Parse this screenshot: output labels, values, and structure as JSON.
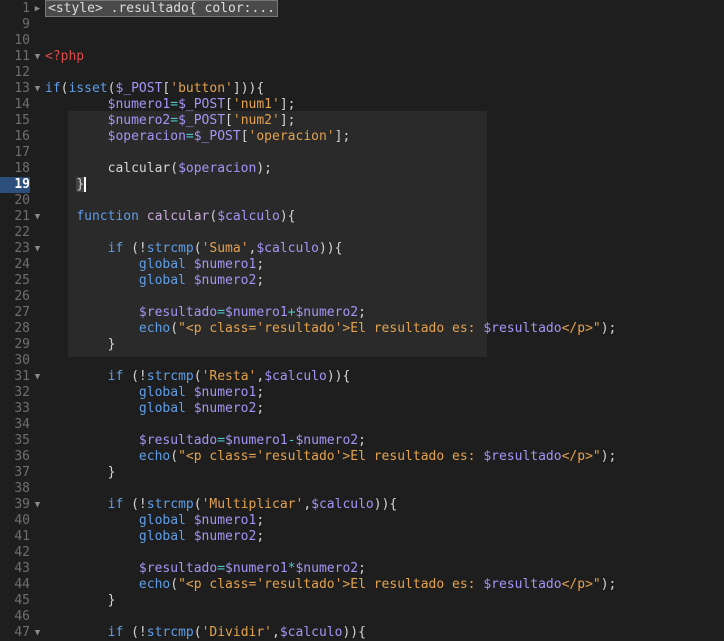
{
  "colors": {
    "background": "#1e1e1e",
    "keyword": "#5f9de8",
    "variable": "#a594f4",
    "string": "#e3a24e",
    "php_tag": "#e04848",
    "active_line": "#2c4f7c"
  },
  "active_line": 19,
  "lines": [
    {
      "n": 1,
      "fold": "collapsed",
      "t": [
        [
          "folded",
          "<style> .resultado{ color:..."
        ]
      ]
    },
    {
      "n": 9,
      "t": []
    },
    {
      "n": 10,
      "t": []
    },
    {
      "n": 11,
      "fold": "open",
      "t": [
        [
          "tag",
          "<?php"
        ]
      ]
    },
    {
      "n": 12,
      "t": []
    },
    {
      "n": 13,
      "fold": "open",
      "t": [
        [
          "kw",
          "if"
        ],
        [
          "p",
          "("
        ],
        [
          "kw",
          "isset"
        ],
        [
          "p",
          "("
        ],
        [
          "var",
          "$_POST"
        ],
        [
          "p",
          "["
        ],
        [
          "str",
          "'button'"
        ],
        [
          "p",
          "])){"
        ]
      ]
    },
    {
      "n": 14,
      "t": [
        [
          "p",
          "        "
        ],
        [
          "var",
          "$numero1"
        ],
        [
          "op",
          "="
        ],
        [
          "var",
          "$_POST"
        ],
        [
          "p",
          "["
        ],
        [
          "str",
          "'num1'"
        ],
        [
          "p",
          "];"
        ]
      ]
    },
    {
      "n": 15,
      "t": [
        [
          "p",
          "        "
        ],
        [
          "var",
          "$numero2"
        ],
        [
          "op",
          "="
        ],
        [
          "var",
          "$_POST"
        ],
        [
          "p",
          "["
        ],
        [
          "str",
          "'num2'"
        ],
        [
          "p",
          "];"
        ]
      ]
    },
    {
      "n": 16,
      "t": [
        [
          "p",
          "        "
        ],
        [
          "var",
          "$operacion"
        ],
        [
          "op",
          "="
        ],
        [
          "var",
          "$_POST"
        ],
        [
          "p",
          "["
        ],
        [
          "str",
          "'operacion'"
        ],
        [
          "p",
          "];"
        ]
      ]
    },
    {
      "n": 17,
      "t": []
    },
    {
      "n": 18,
      "t": [
        [
          "p",
          "        calcular("
        ],
        [
          "var",
          "$operacion"
        ],
        [
          "p",
          ");"
        ]
      ]
    },
    {
      "n": 19,
      "t": [
        [
          "p",
          "    "
        ],
        [
          "cursor",
          "}"
        ]
      ]
    },
    {
      "n": 20,
      "t": []
    },
    {
      "n": 21,
      "fold": "open",
      "t": [
        [
          "p",
          "    "
        ],
        [
          "kw",
          "function"
        ],
        [
          "p",
          " "
        ],
        [
          "fn",
          "calcular"
        ],
        [
          "p",
          "("
        ],
        [
          "var",
          "$calculo"
        ],
        [
          "p",
          "){"
        ]
      ]
    },
    {
      "n": 22,
      "t": []
    },
    {
      "n": 23,
      "fold": "open",
      "t": [
        [
          "p",
          "        "
        ],
        [
          "kw",
          "if"
        ],
        [
          "p",
          " (!"
        ],
        [
          "kw",
          "strcmp"
        ],
        [
          "p",
          "("
        ],
        [
          "str",
          "'Suma'"
        ],
        [
          "p",
          ","
        ],
        [
          "var",
          "$calculo"
        ],
        [
          "p",
          ")){"
        ]
      ]
    },
    {
      "n": 24,
      "t": [
        [
          "p",
          "            "
        ],
        [
          "kw",
          "global"
        ],
        [
          "p",
          " "
        ],
        [
          "var",
          "$numero1"
        ],
        [
          "p",
          ";"
        ]
      ]
    },
    {
      "n": 25,
      "t": [
        [
          "p",
          "            "
        ],
        [
          "kw",
          "global"
        ],
        [
          "p",
          " "
        ],
        [
          "var",
          "$numero2"
        ],
        [
          "p",
          ";"
        ]
      ]
    },
    {
      "n": 26,
      "t": []
    },
    {
      "n": 27,
      "t": [
        [
          "p",
          "            "
        ],
        [
          "var",
          "$resultado"
        ],
        [
          "op",
          "="
        ],
        [
          "var",
          "$numero1"
        ],
        [
          "op",
          "+"
        ],
        [
          "var",
          "$numero2"
        ],
        [
          "p",
          ";"
        ]
      ]
    },
    {
      "n": 28,
      "t": [
        [
          "p",
          "            "
        ],
        [
          "kw",
          "echo"
        ],
        [
          "p",
          "("
        ],
        [
          "str",
          "\"<p class='resultado'>El resultado es: "
        ],
        [
          "var",
          "$resultado"
        ],
        [
          "str",
          "</p>\""
        ],
        [
          "p",
          ");"
        ]
      ]
    },
    {
      "n": 29,
      "t": [
        [
          "p",
          "        }"
        ]
      ]
    },
    {
      "n": 30,
      "t": []
    },
    {
      "n": 31,
      "fold": "open",
      "t": [
        [
          "p",
          "        "
        ],
        [
          "kw",
          "if"
        ],
        [
          "p",
          " (!"
        ],
        [
          "kw",
          "strcmp"
        ],
        [
          "p",
          "("
        ],
        [
          "str",
          "'Resta'"
        ],
        [
          "p",
          ","
        ],
        [
          "var",
          "$calculo"
        ],
        [
          "p",
          ")){"
        ]
      ]
    },
    {
      "n": 32,
      "t": [
        [
          "p",
          "            "
        ],
        [
          "kw",
          "global"
        ],
        [
          "p",
          " "
        ],
        [
          "var",
          "$numero1"
        ],
        [
          "p",
          ";"
        ]
      ]
    },
    {
      "n": 33,
      "t": [
        [
          "p",
          "            "
        ],
        [
          "kw",
          "global"
        ],
        [
          "p",
          " "
        ],
        [
          "var",
          "$numero2"
        ],
        [
          "p",
          ";"
        ]
      ]
    },
    {
      "n": 34,
      "t": []
    },
    {
      "n": 35,
      "t": [
        [
          "p",
          "            "
        ],
        [
          "var",
          "$resultado"
        ],
        [
          "op",
          "="
        ],
        [
          "var",
          "$numero1"
        ],
        [
          "op",
          "-"
        ],
        [
          "var",
          "$numero2"
        ],
        [
          "p",
          ";"
        ]
      ]
    },
    {
      "n": 36,
      "t": [
        [
          "p",
          "            "
        ],
        [
          "kw",
          "echo"
        ],
        [
          "p",
          "("
        ],
        [
          "str",
          "\"<p class='resultado'>El resultado es: "
        ],
        [
          "var",
          "$resultado"
        ],
        [
          "str",
          "</p>\""
        ],
        [
          "p",
          ");"
        ]
      ]
    },
    {
      "n": 37,
      "t": [
        [
          "p",
          "        }"
        ]
      ]
    },
    {
      "n": 38,
      "t": []
    },
    {
      "n": 39,
      "fold": "open",
      "t": [
        [
          "p",
          "        "
        ],
        [
          "kw",
          "if"
        ],
        [
          "p",
          " (!"
        ],
        [
          "kw",
          "strcmp"
        ],
        [
          "p",
          "("
        ],
        [
          "str",
          "'Multiplicar'"
        ],
        [
          "p",
          ","
        ],
        [
          "var",
          "$calculo"
        ],
        [
          "p",
          ")){"
        ]
      ]
    },
    {
      "n": 40,
      "t": [
        [
          "p",
          "            "
        ],
        [
          "kw",
          "global"
        ],
        [
          "p",
          " "
        ],
        [
          "var",
          "$numero1"
        ],
        [
          "p",
          ";"
        ]
      ]
    },
    {
      "n": 41,
      "t": [
        [
          "p",
          "            "
        ],
        [
          "kw",
          "global"
        ],
        [
          "p",
          " "
        ],
        [
          "var",
          "$numero2"
        ],
        [
          "p",
          ";"
        ]
      ]
    },
    {
      "n": 42,
      "t": []
    },
    {
      "n": 43,
      "t": [
        [
          "p",
          "            "
        ],
        [
          "var",
          "$resultado"
        ],
        [
          "op",
          "="
        ],
        [
          "var",
          "$numero1"
        ],
        [
          "op",
          "*"
        ],
        [
          "var",
          "$numero2"
        ],
        [
          "p",
          ";"
        ]
      ]
    },
    {
      "n": 44,
      "t": [
        [
          "p",
          "            "
        ],
        [
          "kw",
          "echo"
        ],
        [
          "p",
          "("
        ],
        [
          "str",
          "\"<p class='resultado'>El resultado es: "
        ],
        [
          "var",
          "$resultado"
        ],
        [
          "str",
          "</p>\""
        ],
        [
          "p",
          ");"
        ]
      ]
    },
    {
      "n": 45,
      "t": [
        [
          "p",
          "        }"
        ]
      ]
    },
    {
      "n": 46,
      "t": []
    },
    {
      "n": 47,
      "fold": "open",
      "t": [
        [
          "p",
          "        "
        ],
        [
          "kw",
          "if"
        ],
        [
          "p",
          " (!"
        ],
        [
          "kw",
          "strcmp"
        ],
        [
          "p",
          "("
        ],
        [
          "str",
          "'Dividir'"
        ],
        [
          "p",
          ","
        ],
        [
          "var",
          "$calculo"
        ],
        [
          "p",
          ")){"
        ]
      ]
    }
  ]
}
